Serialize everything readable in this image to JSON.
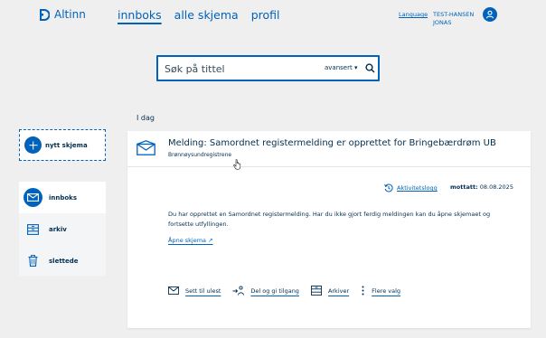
{
  "header": {
    "logo_text": "Altinn",
    "nav": [
      "innboks",
      "alle skjema",
      "profil"
    ],
    "language": "Language",
    "user_line1": "TEST-HANSEN",
    "user_line2": "JONAS"
  },
  "search": {
    "placeholder": "Søk på tittel",
    "advanced": "avansert ▾"
  },
  "sidebar": {
    "new_form": "nytt skjema",
    "items": [
      {
        "label": "innboks",
        "icon": "envelope-icon"
      },
      {
        "label": "arkiv",
        "icon": "archive-icon"
      },
      {
        "label": "slettede",
        "icon": "trash-icon"
      }
    ]
  },
  "main": {
    "day_label": "I dag",
    "message": {
      "title": "Melding: Samordnet registermelding er opprettet for Bringebærdrøm UB",
      "sender": "Brønnøysundregistrene",
      "activity_log": "Aktivitetslogg",
      "received_label": "mottatt:",
      "received_date": "08.08.2025",
      "body": "Du har opprettet en Samordnet registermelding. Har du ikke gjort ferdig meldingen kan du åpne skjemaet og fortsette utfyllingen.",
      "open_form": "Åpne skjema ↗",
      "actions": [
        {
          "label": "Sett til ulest",
          "icon": "envelope-icon"
        },
        {
          "label": "Del og gi tilgang",
          "icon": "share-icon"
        },
        {
          "label": "Arkiver",
          "icon": "archive-icon"
        },
        {
          "label": "Flere valg",
          "icon": "more-vertical-icon"
        }
      ]
    }
  },
  "colors": {
    "accent": "#0062ba",
    "text": "#022f51",
    "background": "#efefef"
  }
}
